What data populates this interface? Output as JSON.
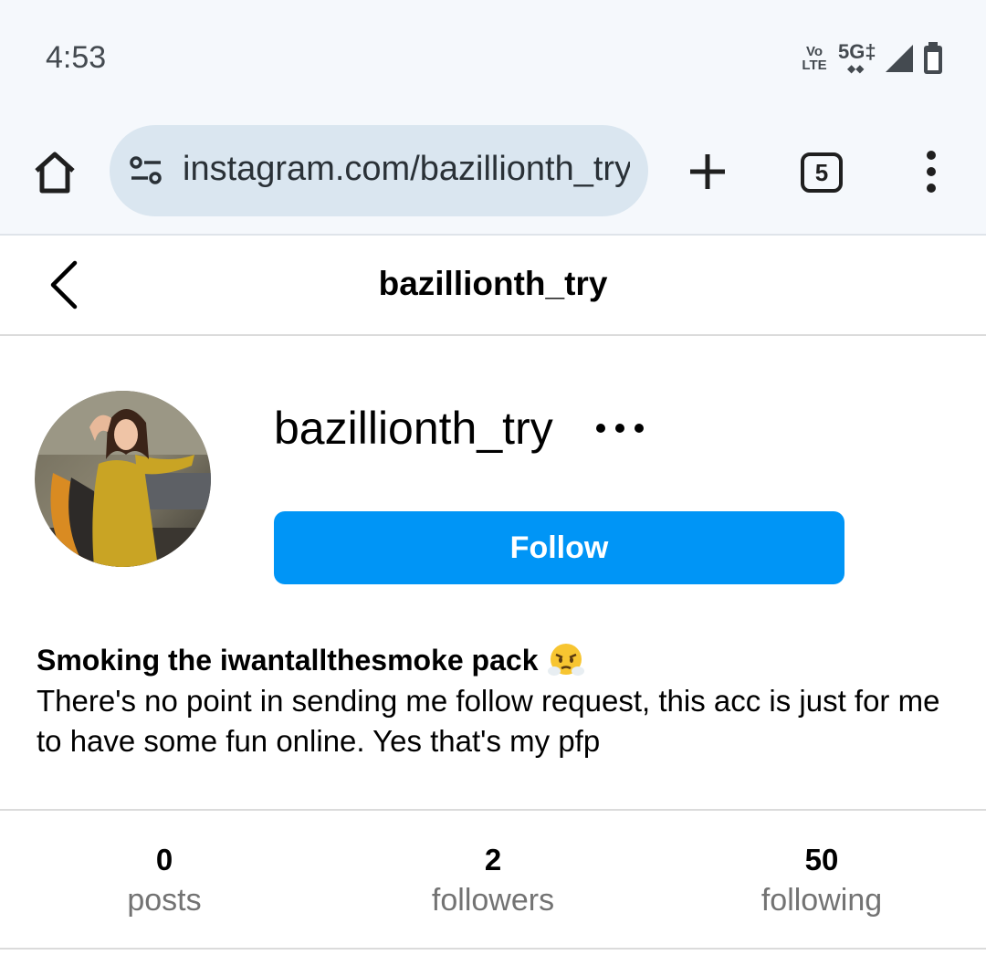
{
  "status_bar": {
    "time": "4:53",
    "volte_top": "Vo",
    "volte_bottom": "LTE",
    "network": "5G",
    "network_suffix": "‡",
    "icons": [
      "volte-icon",
      "5g-icon",
      "signal-icon",
      "battery-icon"
    ]
  },
  "browser": {
    "url": "instagram.com/bazillionth_try",
    "tab_count": "5",
    "icons": [
      "home-icon",
      "site-settings-icon",
      "plus-icon",
      "tabs-icon",
      "more-vert-icon"
    ]
  },
  "header": {
    "title": "bazillionth_try"
  },
  "profile": {
    "username": "bazillionth_try",
    "follow_label": "Follow",
    "bio_name": "Smoking the iwantallthesmoke pack",
    "bio_emoji": "face-with-steam-icon",
    "bio_text": "There's no point in sending me follow request, this acc is just for me to have some fun online. Yes that's my pfp"
  },
  "stats": [
    {
      "value": "0",
      "label": "posts"
    },
    {
      "value": "2",
      "label": "followers"
    },
    {
      "value": "50",
      "label": "following"
    }
  ],
  "colors": {
    "accent": "#0095f6",
    "browser_bg": "#f5f8fc",
    "url_pill": "#dae6f0",
    "muted_text": "#737373"
  }
}
